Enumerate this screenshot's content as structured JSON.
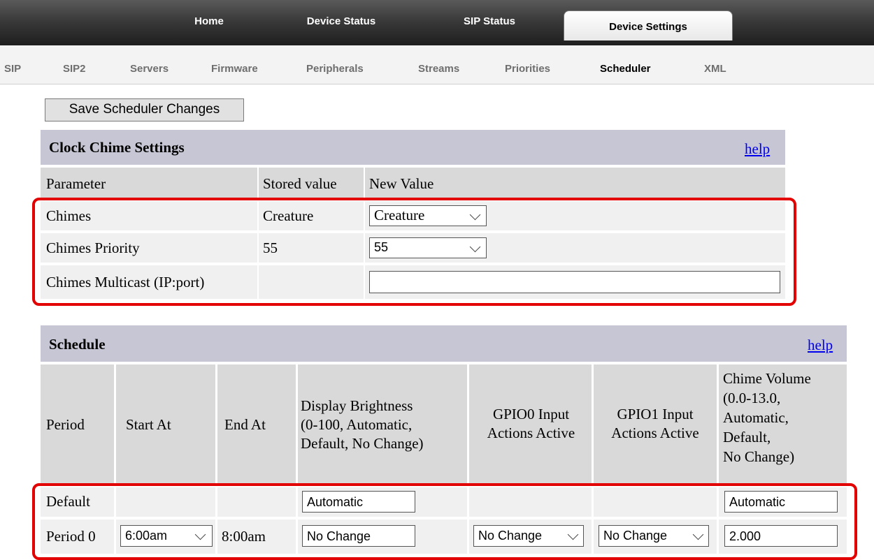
{
  "topnav": {
    "tabs": [
      "Home",
      "Device Status",
      "SIP Status",
      "Device Settings"
    ],
    "active": "Device Settings"
  },
  "subnav": {
    "items": [
      "SIP",
      "SIP2",
      "Servers",
      "Firmware",
      "Peripherals",
      "Streams",
      "Priorities",
      "Scheduler",
      "XML"
    ],
    "active": "Scheduler"
  },
  "save_button": "Save Scheduler Changes",
  "chime_settings": {
    "title": "Clock Chime Settings",
    "help": "help",
    "headers": [
      "Parameter",
      "Stored value",
      "New Value"
    ],
    "rows": [
      {
        "param": "Chimes",
        "stored": "Creature",
        "new": "Creature"
      },
      {
        "param": "Chimes Priority",
        "stored": "55",
        "new": "55"
      },
      {
        "param": "Chimes Multicast (IP:port)",
        "stored": "",
        "new": ""
      }
    ]
  },
  "schedule": {
    "title": "Schedule",
    "help": "help",
    "headers": {
      "period": "Period",
      "start": "Start At",
      "end": "End At",
      "brightness_lines": [
        "Display Brightness",
        "(0-100, Automatic,",
        "Default, No Change)"
      ],
      "gpio0_lines": [
        "GPIO0 Input",
        "Actions Active"
      ],
      "gpio1_lines": [
        "GPIO1 Input",
        "Actions Active"
      ],
      "volume_lines": [
        "Chime Volume",
        "(0.0-13.0,",
        "Automatic,",
        "Default,",
        "No Change)"
      ]
    },
    "rows": [
      {
        "period": "Default",
        "start": "",
        "end": "",
        "brightness": "Automatic",
        "gpio0": "",
        "gpio1": "",
        "volume": "Automatic"
      },
      {
        "period": "Period 0",
        "start": "6:00am",
        "end": "8:00am",
        "brightness": "No Change",
        "gpio0": "No Change",
        "gpio1": "No Change",
        "volume": "2.000"
      }
    ]
  },
  "colors": {
    "section_header": "#c6c6d4",
    "header_row": "#d9d9d9",
    "row_bg": "#f0f0f0",
    "highlight": "#e30000",
    "link": "#0000ee"
  }
}
